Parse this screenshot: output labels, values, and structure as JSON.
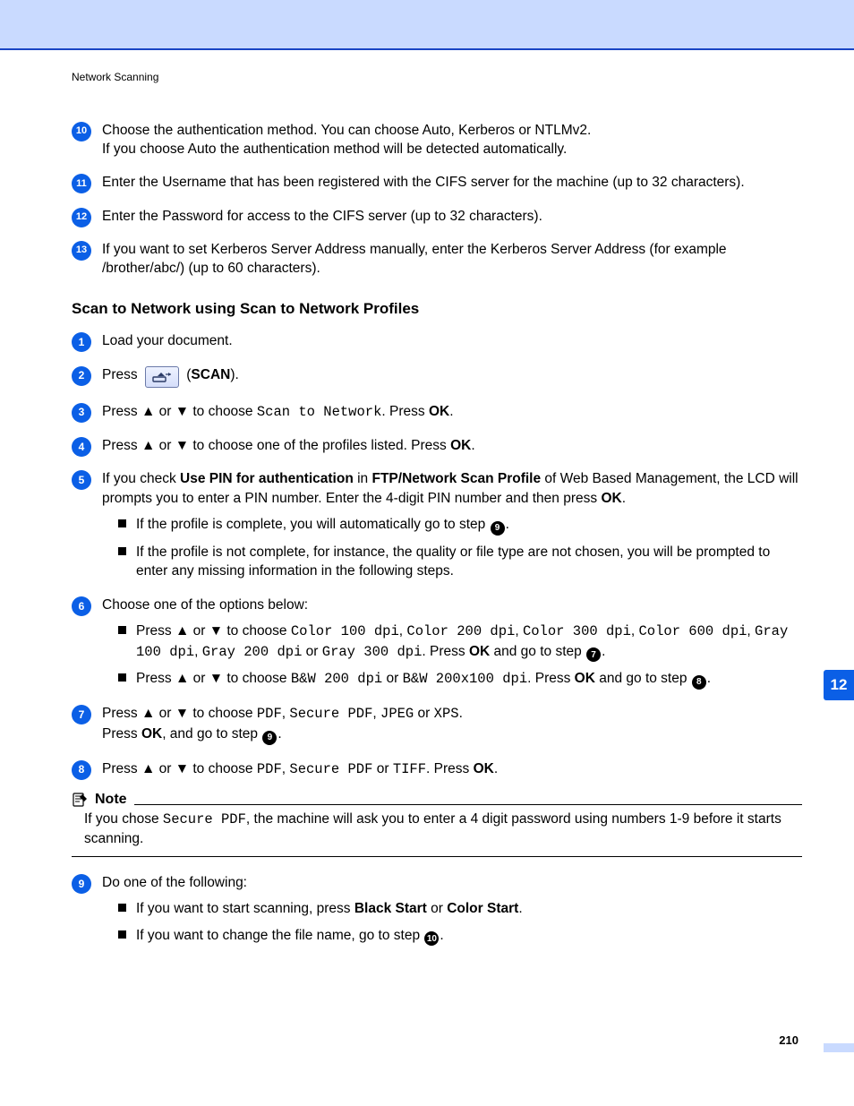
{
  "running_head": "Network Scanning",
  "chapter_tab": "12",
  "page_number": "210",
  "cont_steps": {
    "s10_a": "Choose the authentication method. You can choose Auto, Kerberos or NTLMv2.",
    "s10_b": "If you choose Auto the authentication method will be detected automatically.",
    "s11": "Enter the Username that has been registered with the CIFS server for the machine (up to 32 characters).",
    "s12": "Enter the Password for access to the CIFS server (up to 32 characters).",
    "s13": "If you want to set Kerberos Server Address manually, enter the Kerberos Server Address (for example /brother/abc/) (up to 60 characters)."
  },
  "section_title": "Scan to Network using Scan to Network Profiles",
  "steps": {
    "s1": "Load your document.",
    "s2_pre": "Press",
    "s2_post_open": " (",
    "s2_scan": "SCAN",
    "s2_post_close": ").",
    "s3_a": "Press ",
    "s3_b": " or ",
    "s3_c": " to choose ",
    "s3_code": "Scan to Network",
    "s3_d": ". Press ",
    "s3_ok": "OK",
    "s3_e": ".",
    "s4_a": "Press ",
    "s4_b": " or ",
    "s4_c": " to choose one of the profiles listed. Press ",
    "s4_ok": "OK",
    "s4_d": ".",
    "s5_a": "If you check ",
    "s5_b1": "Use PIN for authentication",
    "s5_c": " in ",
    "s5_b2": "FTP/Network Scan Profile",
    "s5_d": " of Web Based Management, the LCD will prompts you to enter a PIN number. Enter the 4-digit PIN number and then press ",
    "s5_ok": "OK",
    "s5_e": ".",
    "s5_sub1_a": "If the profile is complete, you will automatically go to step ",
    "s5_sub1_b": ".",
    "s5_sub2": "If the profile is not complete, for instance, the quality or file type are not chosen, you will be prompted to enter any missing information in the following steps.",
    "s6": "Choose one of the options below:",
    "s6_sub1_a": "Press ",
    "s6_sub1_b": " or ",
    "s6_sub1_c": " to choose ",
    "s6_sub1_codes": {
      "c1": "Color 100 dpi",
      "c2": "Color 200 dpi",
      "c3": "Color 300 dpi",
      "c4": "Color 600 dpi",
      "c5": "Gray 100 dpi",
      "c6": "Gray 200 dpi",
      "c7": "Gray 300 dpi"
    },
    "s6_sub1_sep": ", ",
    "s6_sub1_or": " or ",
    "s6_sub1_d": ". Press ",
    "s6_sub1_ok": "OK",
    "s6_sub1_e": " and go to step ",
    "s6_sub1_f": ".",
    "s6_sub2_a": "Press ",
    "s6_sub2_b": " or ",
    "s6_sub2_c": " to choose ",
    "s6_sub2_codes": {
      "c1": "B&W 200 dpi",
      "c2": "B&W 200x100 dpi"
    },
    "s6_sub2_or": " or ",
    "s6_sub2_d": ". Press ",
    "s6_sub2_ok": "OK",
    "s6_sub2_e": " and go to step ",
    "s6_sub2_f": ".",
    "s7_a": "Press ",
    "s7_b": " or ",
    "s7_c": " to choose ",
    "s7_codes": {
      "c1": "PDF",
      "c2": "Secure PDF",
      "c3": "JPEG",
      "c4": "XPS"
    },
    "s7_sep": ", ",
    "s7_or": " or ",
    "s7_d": ".",
    "s7_e": "Press ",
    "s7_ok": "OK",
    "s7_f": ", and go to step ",
    "s7_g": ".",
    "s8_a": "Press ",
    "s8_b": " or ",
    "s8_c": " to choose ",
    "s8_codes": {
      "c1": "PDF",
      "c2": "Secure PDF",
      "c3": "TIFF"
    },
    "s8_sep": ", ",
    "s8_or": " or ",
    "s8_d": ". Press ",
    "s8_ok": "OK",
    "s8_e": ".",
    "s9": "Do one of the following:",
    "s9_sub1_a": "If you want to start scanning, press ",
    "s9_sub1_b1": "Black Start",
    "s9_sub1_b": " or ",
    "s9_sub1_b2": "Color Start",
    "s9_sub1_c": ".",
    "s9_sub2_a": "If you want to change the file name, go to step ",
    "s9_sub2_b": "."
  },
  "note": {
    "title": "Note",
    "a": "If you chose ",
    "code": "Secure PDF",
    "b": ", the machine will ask you to enter a 4 digit password using numbers 1-9 before it starts scanning."
  },
  "ref": {
    "seven": "7",
    "eight": "8",
    "nine": "9",
    "ten": "10"
  },
  "arrows": {
    "up": "▲",
    "down": "▼"
  },
  "badge": {
    "b10": "10",
    "b11": "11",
    "b12": "12",
    "b13": "13",
    "b1": "1",
    "b2": "2",
    "b3": "3",
    "b4": "4",
    "b5": "5",
    "b6": "6",
    "b7": "7",
    "b8": "8",
    "b9": "9"
  }
}
